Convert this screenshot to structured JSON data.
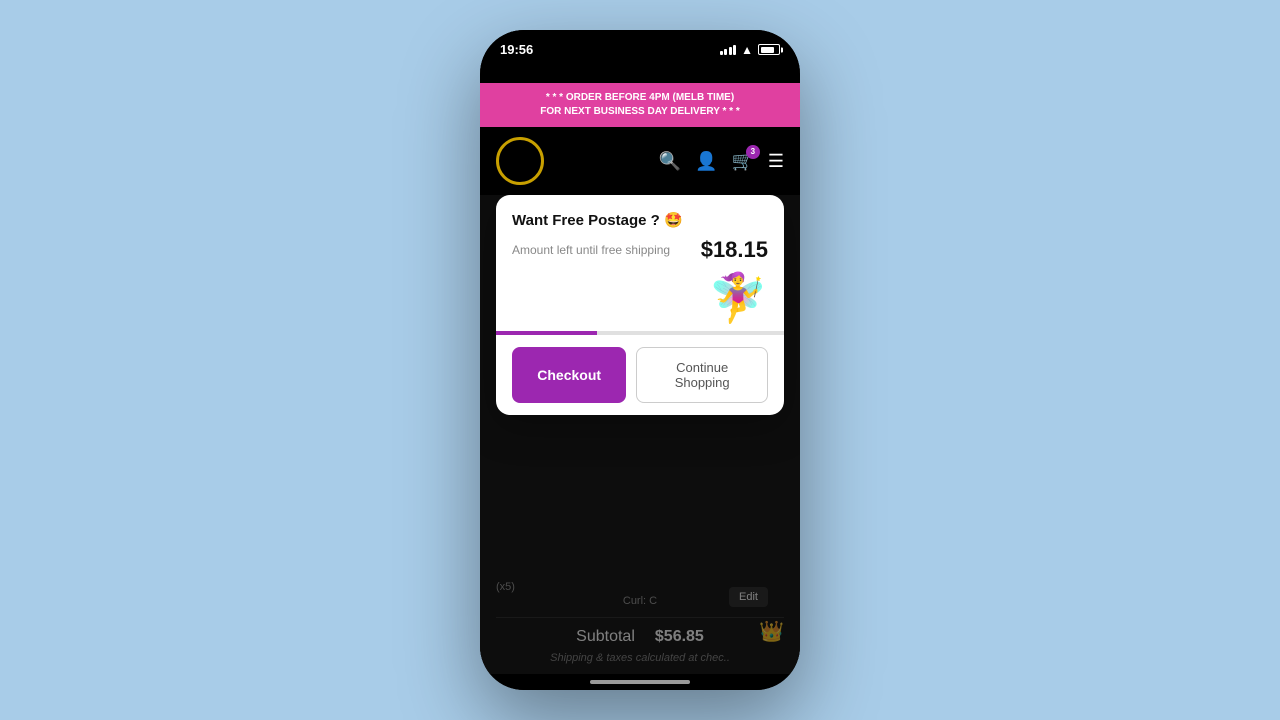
{
  "status_bar": {
    "time": "19:56"
  },
  "promo_banner": {
    "line1": "* * * ORDER BEFORE 4PM (MELB TIME)",
    "line2": "FOR NEXT BUSINESS DAY DELIVERY * * *"
  },
  "header": {
    "cart_count": "3"
  },
  "modal": {
    "title": "Want Free Postage ? 🤩",
    "shipping_label": "Amount left until free shipping",
    "shipping_amount": "$18.15",
    "progress_percent": 35,
    "checkout_label": "Checkout",
    "continue_label": "Continue Shopping"
  },
  "cart": {
    "item_qty": "(x5)",
    "item_curl": "Curl:  C",
    "edit_label": "Edit",
    "subtotal_label": "Subtotal",
    "subtotal_amount": "$56.85",
    "shipping_note": "Shipping & taxes calculated at chec.."
  }
}
